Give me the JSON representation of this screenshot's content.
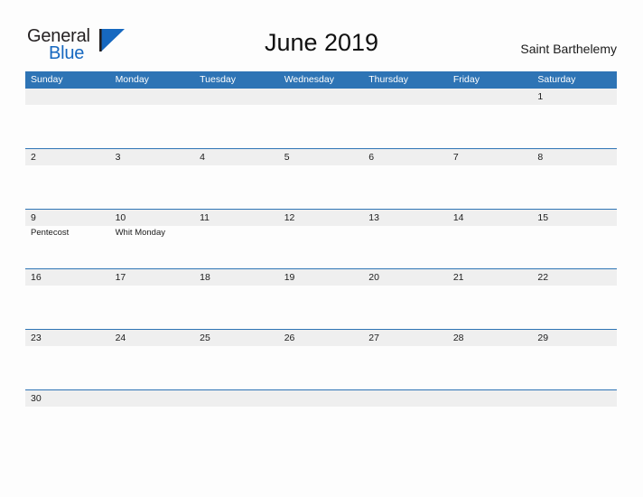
{
  "brand": {
    "name_part1": "General",
    "name_part2": "Blue",
    "flag_icon": "triangle-flag-icon",
    "color_dark": "#231f20",
    "color_blue": "#1668c0",
    "flag_color": "#1668c0"
  },
  "header": {
    "title": "June 2019",
    "location": "Saint Barthelemy",
    "accent_color": "#2e74b5",
    "band_color": "#efefef"
  },
  "calendar": {
    "weekdays": [
      "Sunday",
      "Monday",
      "Tuesday",
      "Wednesday",
      "Thursday",
      "Friday",
      "Saturday"
    ],
    "weeks": [
      {
        "days": [
          {
            "number": "",
            "event": ""
          },
          {
            "number": "",
            "event": ""
          },
          {
            "number": "",
            "event": ""
          },
          {
            "number": "",
            "event": ""
          },
          {
            "number": "",
            "event": ""
          },
          {
            "number": "",
            "event": ""
          },
          {
            "number": "1",
            "event": ""
          }
        ]
      },
      {
        "days": [
          {
            "number": "2",
            "event": ""
          },
          {
            "number": "3",
            "event": ""
          },
          {
            "number": "4",
            "event": ""
          },
          {
            "number": "5",
            "event": ""
          },
          {
            "number": "6",
            "event": ""
          },
          {
            "number": "7",
            "event": ""
          },
          {
            "number": "8",
            "event": ""
          }
        ]
      },
      {
        "days": [
          {
            "number": "9",
            "event": "Pentecost"
          },
          {
            "number": "10",
            "event": "Whit Monday"
          },
          {
            "number": "11",
            "event": ""
          },
          {
            "number": "12",
            "event": ""
          },
          {
            "number": "13",
            "event": ""
          },
          {
            "number": "14",
            "event": ""
          },
          {
            "number": "15",
            "event": ""
          }
        ]
      },
      {
        "days": [
          {
            "number": "16",
            "event": ""
          },
          {
            "number": "17",
            "event": ""
          },
          {
            "number": "18",
            "event": ""
          },
          {
            "number": "19",
            "event": ""
          },
          {
            "number": "20",
            "event": ""
          },
          {
            "number": "21",
            "event": ""
          },
          {
            "number": "22",
            "event": ""
          }
        ]
      },
      {
        "days": [
          {
            "number": "23",
            "event": ""
          },
          {
            "number": "24",
            "event": ""
          },
          {
            "number": "25",
            "event": ""
          },
          {
            "number": "26",
            "event": ""
          },
          {
            "number": "27",
            "event": ""
          },
          {
            "number": "28",
            "event": ""
          },
          {
            "number": "29",
            "event": ""
          }
        ]
      },
      {
        "days": [
          {
            "number": "30",
            "event": ""
          },
          {
            "number": "",
            "event": ""
          },
          {
            "number": "",
            "event": ""
          },
          {
            "number": "",
            "event": ""
          },
          {
            "number": "",
            "event": ""
          },
          {
            "number": "",
            "event": ""
          },
          {
            "number": "",
            "event": ""
          }
        ]
      }
    ]
  }
}
